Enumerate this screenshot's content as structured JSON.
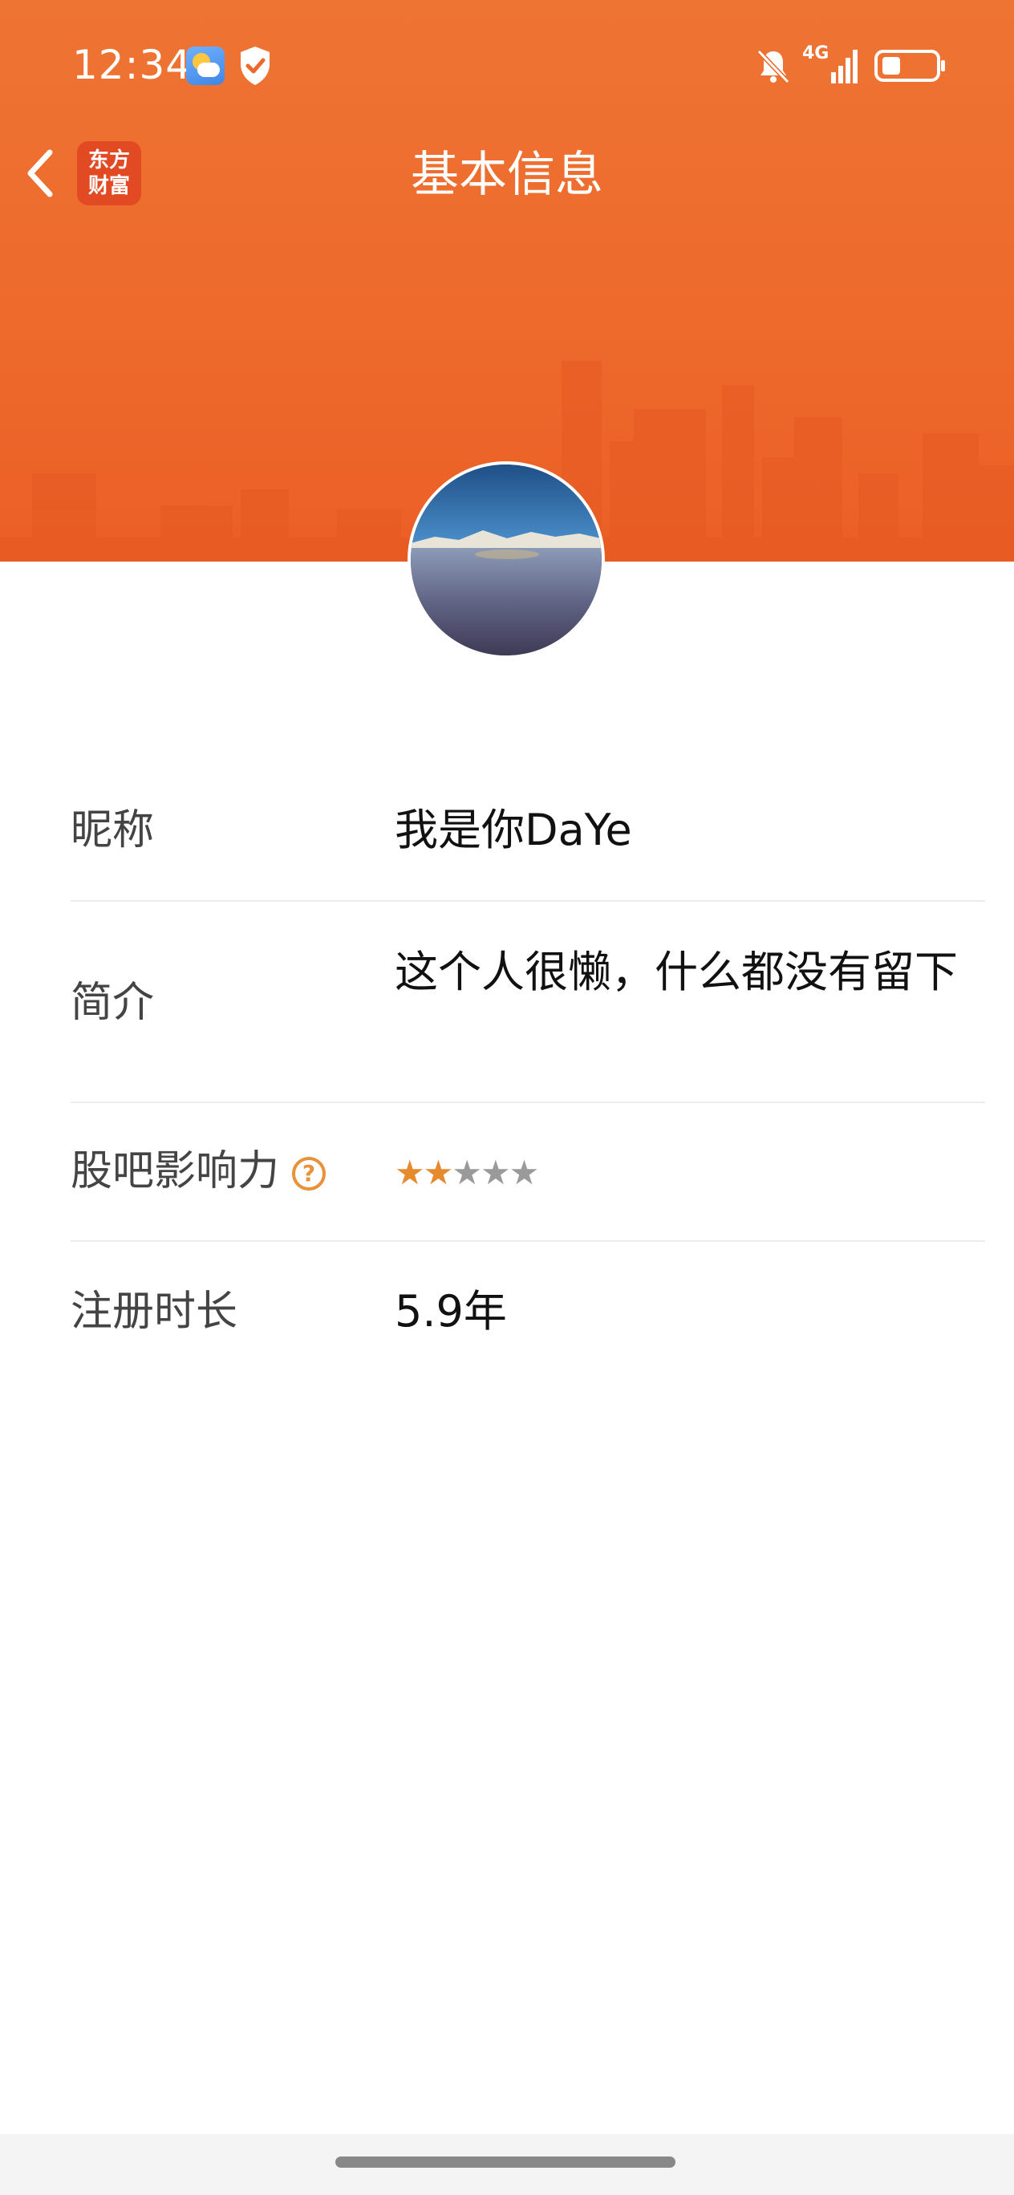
{
  "status_bar": {
    "time": "12:34",
    "network": "4G",
    "icons": [
      "weather-icon",
      "shield-check-icon",
      "mute-bell-icon",
      "signal-icon",
      "battery-icon"
    ]
  },
  "nav": {
    "app_logo_line1": "东方",
    "app_logo_line2": "财富",
    "title": "基本信息"
  },
  "profile": {
    "rows": [
      {
        "label": "昵称",
        "value": "我是你DaYe"
      },
      {
        "label": "简介",
        "value": "这个人很懒，什么都没有留下"
      },
      {
        "label": "股吧影响力",
        "help_icon": "?",
        "stars_filled": 2,
        "stars_total": 5,
        "star_glyph": "★"
      },
      {
        "label": "注册时长",
        "value": "5.9年"
      }
    ]
  },
  "colors": {
    "header": "#ed6a2c",
    "star_filled": "#e58b2e",
    "star_empty": "#9a9a9a",
    "divider": "#ececec"
  }
}
